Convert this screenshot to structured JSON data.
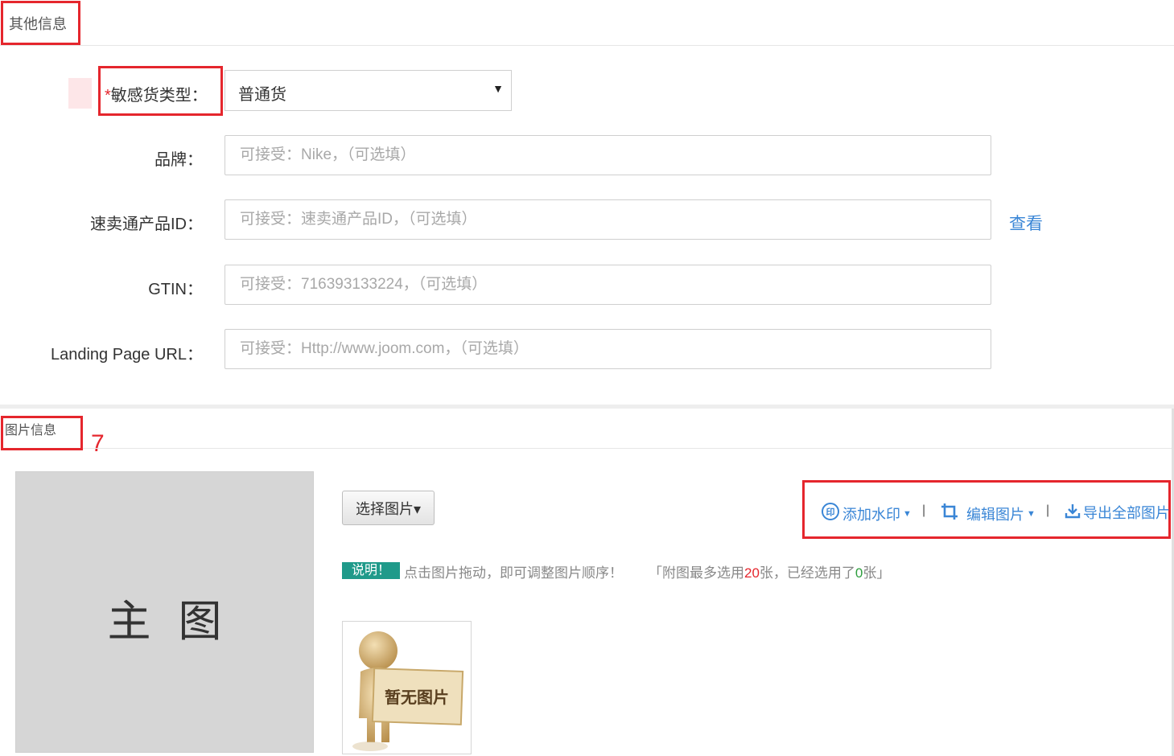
{
  "other_info": {
    "title": "其他信息",
    "sensitive": {
      "required_mark": "*",
      "label": "敏感货类型：",
      "value": "普通货"
    },
    "brand": {
      "label": "品牌：",
      "placeholder": "可接受：Nike，（可选填）"
    },
    "aliexpress_id": {
      "label": "速卖通产品ID：",
      "placeholder": "可接受：速卖通产品ID，（可选填）",
      "link": "查看"
    },
    "gtin": {
      "label": "GTIN：",
      "placeholder": "可接受：716393133224，（可选填）"
    },
    "landing": {
      "label": "Landing Page URL：",
      "placeholder": "可接受：Http://www.joom.com，（可选填）"
    }
  },
  "image_info": {
    "title": "图片信息",
    "annotation": "7",
    "main_image_label": "主图",
    "select_button": "选择图片▾",
    "toolbar": {
      "watermark": "添加水印",
      "edit": "编辑图片",
      "export": "导出全部图片",
      "separator": "|"
    },
    "tip_badge": "说明！",
    "tip_text": "点击图片拖动，即可调整图片顺序！",
    "count_prefix": "「附图最多选用",
    "count_max": "20",
    "count_mid": "张，已经选用了",
    "count_used": "0",
    "count_suffix": "张」",
    "no_image": "暂无图片"
  },
  "colors": {
    "annotation_red": "#e5262d",
    "link_blue": "#3a86d6",
    "badge_teal": "#1f9a8a",
    "count_used_green": "#2e9e3e"
  }
}
